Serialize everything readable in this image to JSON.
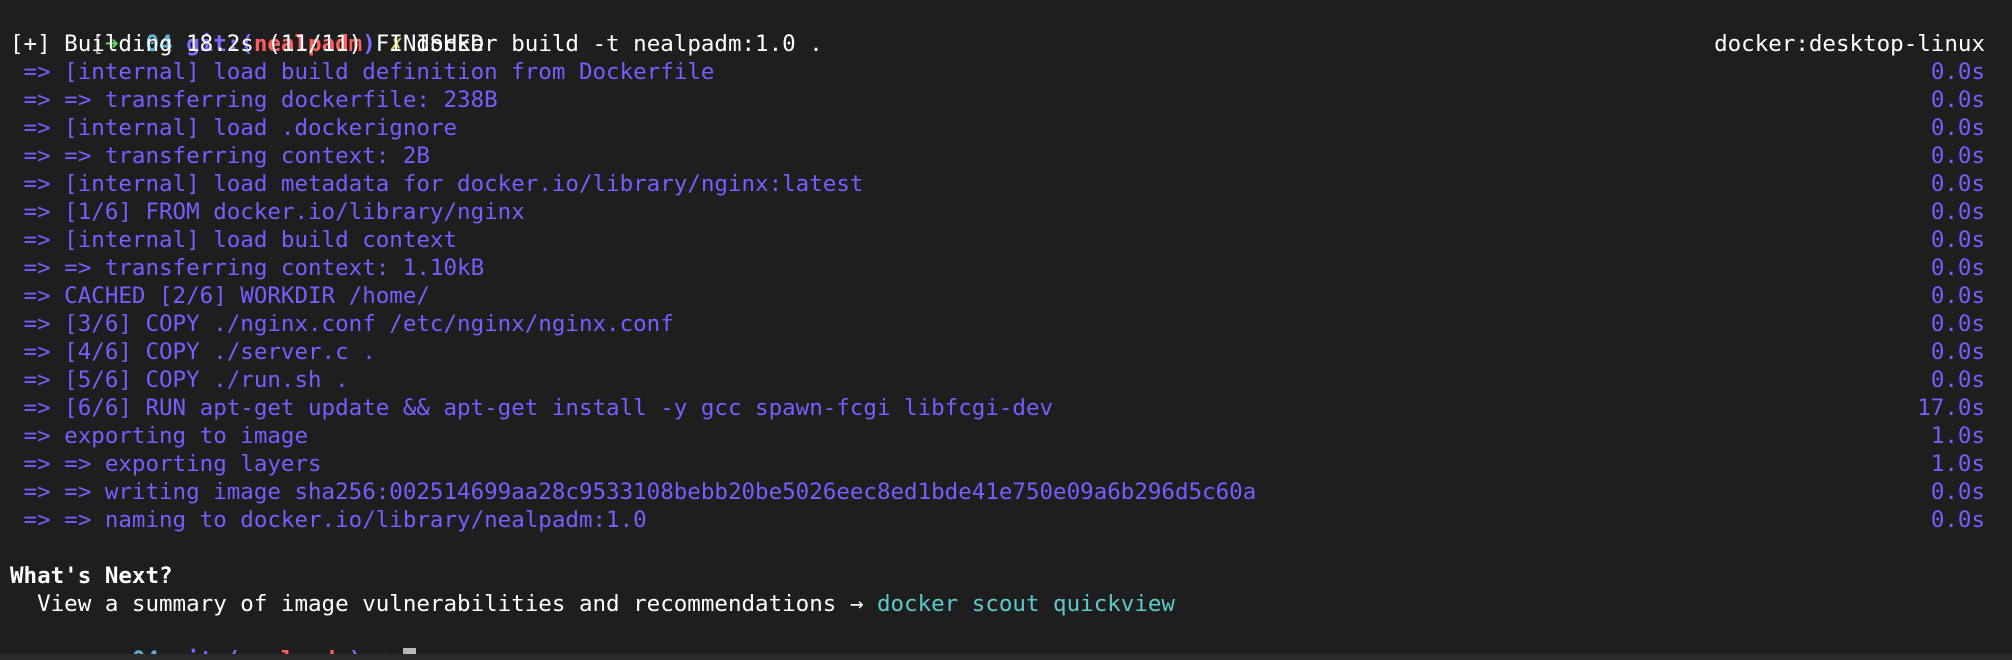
{
  "prompt": {
    "arrow": "➜",
    "dir": "04",
    "git_prefix": "git:(",
    "branch": "nealpadm",
    "git_suffix": ")",
    "dirty_mark": "✗"
  },
  "command": "docker build -t nealpadm:1.0 .",
  "build_header": {
    "text": "[+] Building 18.2s (11/11) FINISHED",
    "context": "docker:desktop-linux"
  },
  "steps": [
    {
      "text": " => [internal] load build definition from Dockerfile",
      "time": "0.0s"
    },
    {
      "text": " => => transferring dockerfile: 238B",
      "time": "0.0s"
    },
    {
      "text": " => [internal] load .dockerignore",
      "time": "0.0s"
    },
    {
      "text": " => => transferring context: 2B",
      "time": "0.0s"
    },
    {
      "text": " => [internal] load metadata for docker.io/library/nginx:latest",
      "time": "0.0s"
    },
    {
      "text": " => [1/6] FROM docker.io/library/nginx",
      "time": "0.0s"
    },
    {
      "text": " => [internal] load build context",
      "time": "0.0s"
    },
    {
      "text": " => => transferring context: 1.10kB",
      "time": "0.0s"
    },
    {
      "text": " => CACHED [2/6] WORKDIR /home/",
      "time": "0.0s"
    },
    {
      "text": " => [3/6] COPY ./nginx.conf /etc/nginx/nginx.conf",
      "time": "0.0s"
    },
    {
      "text": " => [4/6] COPY ./server.c .",
      "time": "0.0s"
    },
    {
      "text": " => [5/6] COPY ./run.sh .",
      "time": "0.0s"
    },
    {
      "text": " => [6/6] RUN apt-get update && apt-get install -y gcc spawn-fcgi libfcgi-dev",
      "time": "17.0s"
    },
    {
      "text": " => exporting to image",
      "time": "1.0s"
    },
    {
      "text": " => => exporting layers",
      "time": "1.0s"
    },
    {
      "text": " => => writing image sha256:002514699aa28c9533108bebb20be5026eec8ed1bde41e750e09a6b296d5c60a",
      "time": "0.0s"
    },
    {
      "text": " => => naming to docker.io/library/nealpadm:1.0",
      "time": "0.0s"
    }
  ],
  "whats_next": {
    "heading": "What's Next?",
    "text": "  View a summary of image vulnerabilities and recommendations → ",
    "command": "docker scout quickview"
  },
  "colors": {
    "background": "#1e1e1e",
    "build_output": "#7a5cff",
    "prompt_arrow": "#5fd75f",
    "prompt_dir": "#5fafd7",
    "prompt_git": "#7b6cff",
    "prompt_branch": "#ff5f5f",
    "prompt_dirty": "#d7d75f",
    "link": "#5fc9d0"
  }
}
